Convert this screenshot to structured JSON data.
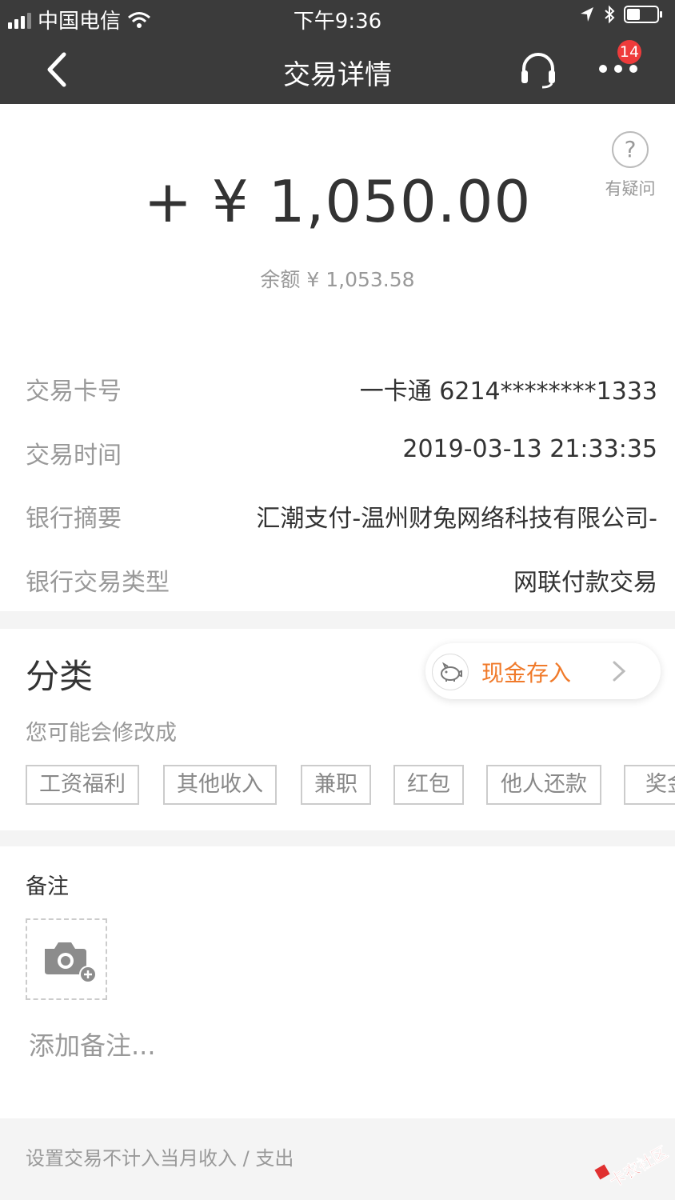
{
  "statusbar": {
    "carrier": "中国电信",
    "time": "下午9:36"
  },
  "navbar": {
    "title": "交易详情",
    "badge": "14"
  },
  "summary": {
    "amount": "+ ¥ 1,050.00",
    "balance": "余额 ¥ 1,053.58",
    "help_label": "有疑问"
  },
  "details": [
    {
      "label": "交易卡号",
      "value": "一卡通 6214********1333"
    },
    {
      "label": "交易时间",
      "value": "2019-03-13 21:33:35"
    },
    {
      "label": "银行摘要",
      "value": "汇潮支付-温州财兔网络科技有限公司-"
    },
    {
      "label": "银行交易类型",
      "value": "网联付款交易"
    }
  ],
  "category": {
    "title": "分类",
    "selected": "现金存入",
    "hint": "您可能会修改成",
    "tags": [
      "工资福利",
      "其他收入",
      "兼职",
      "红包",
      "他人还款",
      "奖金"
    ]
  },
  "note": {
    "title": "备注",
    "placeholder": "添加备注..."
  },
  "footer": {
    "text": "设置交易不计入当月收入 / 支出"
  },
  "watermark": {
    "text": "卡农社区"
  },
  "colors": {
    "navbar": "#3b3b3b",
    "accent": "#f07a2a",
    "badge": "#ef3b3b"
  }
}
